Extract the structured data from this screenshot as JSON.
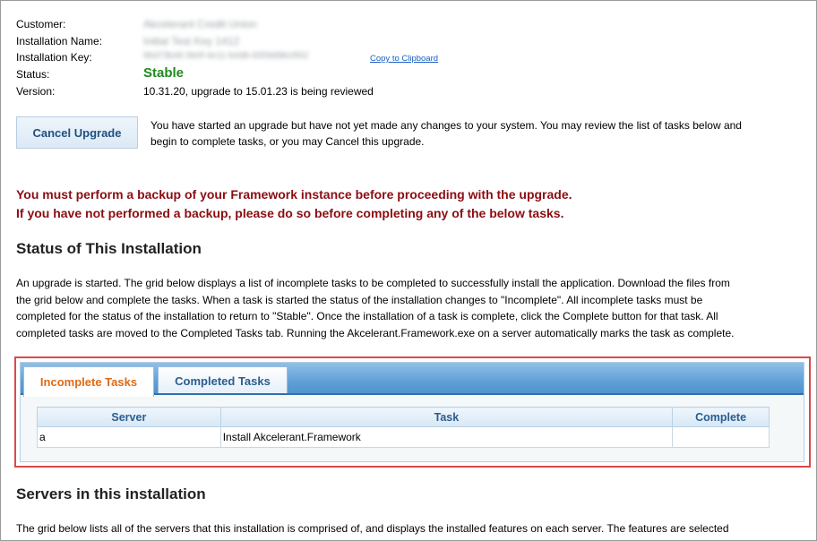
{
  "info": {
    "customer_label": "Customer:",
    "customer_value": "Akcelerant Credit Union",
    "installation_name_label": "Installation Name:",
    "installation_name_value": "Initial Test Key 1412",
    "installation_key_label": "Installation Key:",
    "installation_key_value": "96d73b46-5b0f-4e11-b4d8-0059d98c0f42",
    "copy_link": "Copy to Clipboard",
    "status_label": "Status:",
    "status_value": "Stable",
    "version_label": "Version:",
    "version_value": "10.31.20, upgrade to 15.01.23 is being reviewed"
  },
  "upgrade": {
    "cancel_button": "Cancel Upgrade",
    "message_line1": "You have started an upgrade but have not yet made any changes to your system. You may review the list of tasks below and",
    "message_line2": "begin to complete tasks, or you may Cancel this upgrade."
  },
  "warning": {
    "line1": "You must perform a backup of your Framework instance before proceeding with the upgrade.",
    "line2": "If you have not performed a backup, please do so before completing any of the below tasks."
  },
  "status_section": {
    "title": "Status of This Installation",
    "line1": "An upgrade is started. The grid below displays a list of incomplete tasks to be completed to successfully install the application. Download the files from",
    "line2": "the grid below and complete the tasks. When a task is started the status of the installation changes to \"Incomplete\". All incomplete tasks must be",
    "line3": "completed for the status of the installation to return to \"Stable\". Once the installation of a task is complete, click the Complete button for that task. All",
    "line4": "completed tasks are moved to the Completed Tasks tab. Running the Akcelerant.Framework.exe on a server automatically marks the task as complete."
  },
  "tabs": {
    "incomplete": "Incomplete Tasks",
    "completed": "Completed Tasks"
  },
  "grid": {
    "headers": [
      "Server",
      "Task",
      "Complete"
    ],
    "rows": [
      [
        "a",
        "Install Akcelerant.Framework",
        ""
      ]
    ]
  },
  "servers_section": {
    "title": "Servers in this installation",
    "line1": "The grid below lists all of the servers that this installation is comprised of, and displays the installed features on each server. The features are selected"
  },
  "colors": {
    "stable": "#1e8a1e",
    "warning": "#8b0d12",
    "active_tab": "#e06a13",
    "highlight": "#d94a4a",
    "link": "#1a5ec4"
  }
}
